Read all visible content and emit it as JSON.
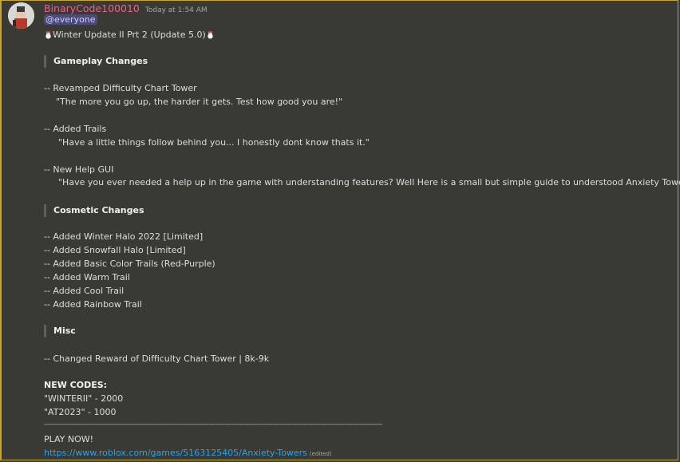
{
  "message": {
    "author": "BinaryCode100010",
    "timestamp": "Today at 1:54 AM",
    "mention": "@everyone",
    "title": "Winter Update II Prt 2 (Update 5.0)",
    "sections": [
      {
        "heading": "Gameplay Changes",
        "items": [
          {
            "text": "-- Revamped Difficulty Chart Tower",
            "quote": "\"The more you go up, the harder it gets. Test how good you are!\""
          },
          {
            "text": "-- Added Trails",
            "quote": "\"Have a little things follow behind you... I honestly dont know thats it.\""
          },
          {
            "text": "-- New Help GUI",
            "quote": "\"Have you ever needed a help up in the game with understanding features? Well Here is a small but simple guide to understood Anxiety Towers\""
          }
        ]
      },
      {
        "heading": "Cosmetic Changes",
        "lines": [
          "-- Added Winter Halo 2022 [Limited]",
          "-- Added Snowfall Halo [Limited]",
          "-- Added Basic Color Trails (Red-Purple)",
          "-- Added Warm Trail",
          "-- Added Cool Trail",
          "-- Added Rainbow Trail"
        ]
      },
      {
        "heading": "Misc",
        "lines": [
          "-- Changed Reward of Difficulty Chart Tower | 8k-9k"
        ]
      }
    ],
    "codes_heading": "NEW CODES:",
    "codes": [
      "\"WINTERII\" - 2000",
      "\"AT2023\" - 1000"
    ],
    "divider": "----------------------------------------------------------------------------------------------------------------------------------------------------------------",
    "play_now": "PLAY NOW!",
    "link": "https://www.roblox.com/games/5163125405/Anxiety-Towers",
    "edited": "(edited)"
  },
  "colors": {
    "background": "#393a34",
    "username": "#ef5e88",
    "link": "#2aa0f2",
    "mention_bg": "#4b4a78",
    "frame": "#c7a434"
  },
  "icons": [
    "avatar",
    "snowman-icon"
  ]
}
